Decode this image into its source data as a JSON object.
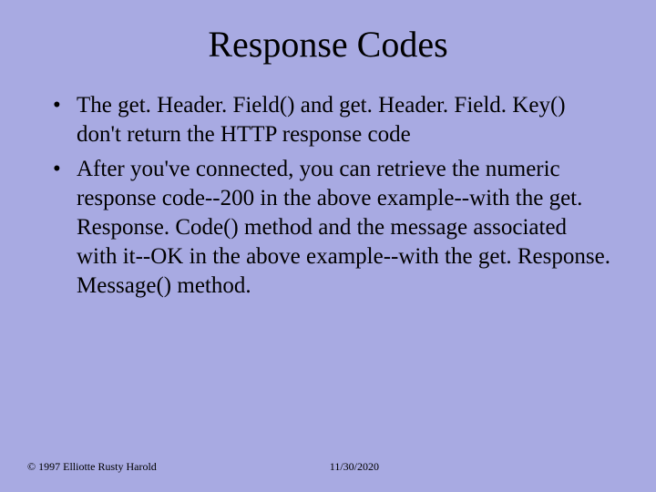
{
  "title": "Response Codes",
  "bullets": [
    "The get. Header. Field() and get. Header. Field. Key() don't return the HTTP response code",
    "After you've connected, you can retrieve the numeric response code--200 in the above example--with the get. Response. Code() method and the message associated with it--OK in the above example--with the get. Response. Message() method."
  ],
  "footer": {
    "copyright": "© 1997 Elliotte Rusty Harold",
    "date": "11/30/2020"
  }
}
